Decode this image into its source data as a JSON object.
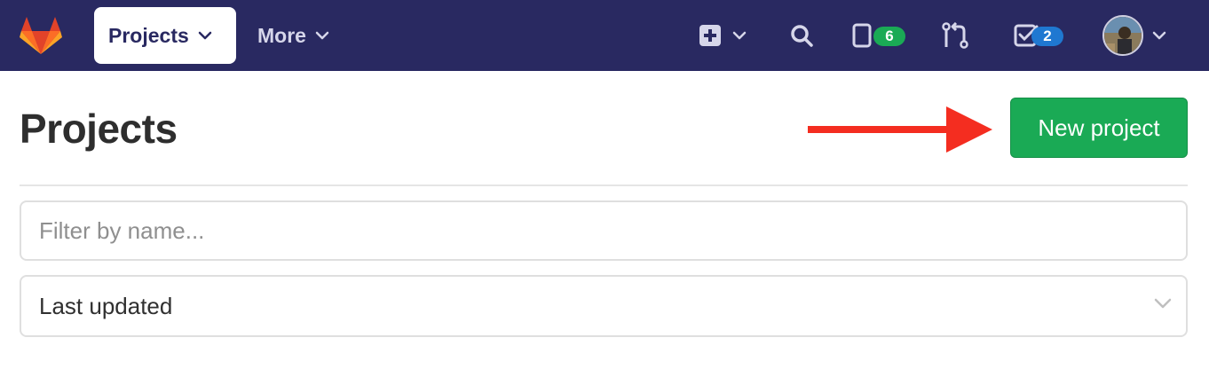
{
  "navbar": {
    "projects_label": "Projects",
    "more_label": "More",
    "issues_count": "6",
    "todos_count": "2",
    "background": "#292961"
  },
  "page": {
    "title": "Projects",
    "new_project_label": "New project",
    "accent": "#1aaa55"
  },
  "filter": {
    "placeholder": "Filter by name...",
    "value": ""
  },
  "sort": {
    "selected": "Last updated"
  },
  "icons": [
    "gitlab-logo",
    "chevron-down-icon",
    "plus-square-icon",
    "search-icon",
    "issues-icon",
    "merge-request-icon",
    "todo-icon",
    "avatar",
    "arrow-icon"
  ]
}
